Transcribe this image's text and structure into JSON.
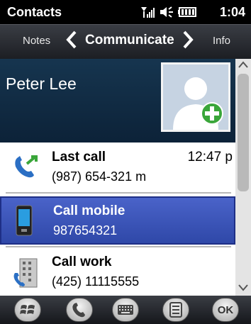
{
  "status_bar": {
    "app_title": "Contacts",
    "time": "1:04"
  },
  "tabs": {
    "left": "Notes",
    "center": "Communicate",
    "right": "Info"
  },
  "contact": {
    "name": "Peter Lee"
  },
  "list": [
    {
      "title": "Last call",
      "subtitle": "(987) 654-321 m",
      "time": "12:47 p",
      "icon": "phone-forward-icon",
      "selected": false
    },
    {
      "title": "Call mobile",
      "subtitle": "987654321",
      "icon": "mobile-phone-icon",
      "selected": true
    },
    {
      "title": "Call work",
      "subtitle": "(425) 11115555",
      "icon": "office-building-phone-icon",
      "selected": false
    }
  ],
  "softkeys": [
    "windows-start",
    "phone",
    "keyboard",
    "menu",
    "ok"
  ],
  "softkey_ok_label": "OK",
  "colors": {
    "selection": "#2f48a8",
    "header": "#0c2238"
  }
}
